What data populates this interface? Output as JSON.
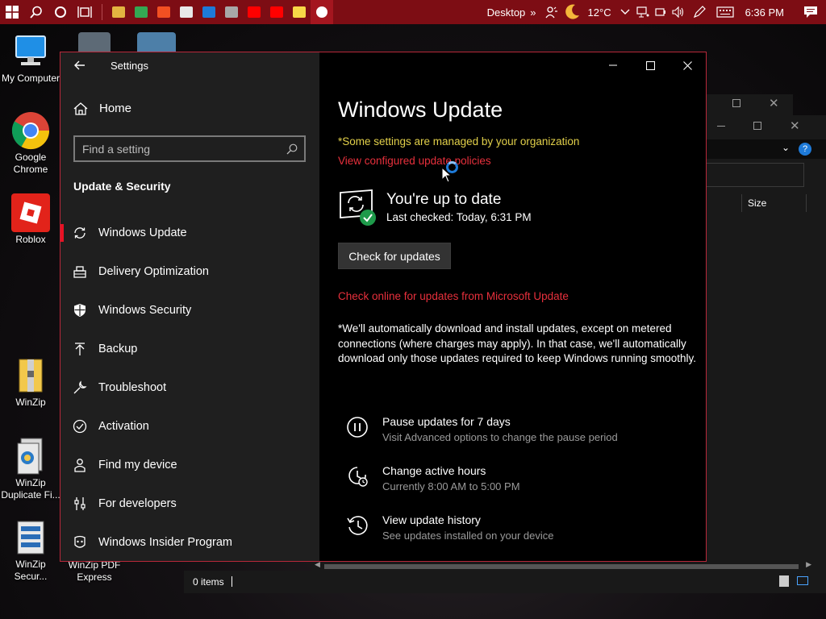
{
  "taskbar": {
    "desktop_label": "Desktop",
    "overflow_label": "»",
    "weather": "12°C",
    "time": "6:36 PM",
    "pinned_apps": [
      {
        "name": "file-explorer",
        "color": "#e3b341"
      },
      {
        "name": "chrome",
        "color": "#34a853"
      },
      {
        "name": "store",
        "color": "#f25022"
      },
      {
        "name": "roblox",
        "color": "#e8e8e8"
      },
      {
        "name": "remote",
        "color": "#1e7ad8"
      },
      {
        "name": "photos",
        "color": "#a8a8a8"
      },
      {
        "name": "youtube",
        "color": "#ff0000"
      },
      {
        "name": "youtube-2",
        "color": "#ff0000"
      },
      {
        "name": "sticky-notes",
        "color": "#f7d747"
      },
      {
        "name": "settings",
        "color": "#ffffff"
      }
    ]
  },
  "desktop": {
    "icons": [
      {
        "label": "My Computer",
        "icon": "monitor-icon"
      },
      {
        "label": "Google Chrome",
        "icon": "chrome-icon"
      },
      {
        "label": "Roblox",
        "icon": "roblox-icon"
      },
      {
        "label": "WinZip",
        "icon": "winzip-icon"
      },
      {
        "label": "WinZip Duplicate Fi...",
        "icon": "winzip-duplicate-icon"
      },
      {
        "label": "WinZip Secur...",
        "icon": "winzip-secure-icon"
      },
      {
        "label": "WinZip PDF Express",
        "icon": "winzip-pdf-icon"
      }
    ]
  },
  "explorer": {
    "column_size": "Size",
    "items_count": "0 items"
  },
  "settings": {
    "window_title": "Settings",
    "home_label": "Home",
    "search_placeholder": "Find a setting",
    "section_title": "Update & Security",
    "nav": [
      {
        "label": "Windows Update",
        "icon": "refresh-icon",
        "selected": true
      },
      {
        "label": "Delivery Optimization",
        "icon": "delivery-icon"
      },
      {
        "label": "Windows Security",
        "icon": "shield-icon"
      },
      {
        "label": "Backup",
        "icon": "backup-icon"
      },
      {
        "label": "Troubleshoot",
        "icon": "wrench-icon"
      },
      {
        "label": "Activation",
        "icon": "check-circle-icon"
      },
      {
        "label": "Find my device",
        "icon": "person-pin-icon"
      },
      {
        "label": "For developers",
        "icon": "developer-icon"
      },
      {
        "label": "Windows Insider Program",
        "icon": "insider-icon"
      }
    ],
    "main": {
      "title": "Windows Update",
      "managed_notice": "*Some settings are managed by your organization",
      "policies_link": "View configured update policies",
      "status_title": "You're up to date",
      "status_sub": "Last checked: Today, 6:31 PM",
      "check_button": "Check for updates",
      "online_link": "Check online for updates from Microsoft Update",
      "note": "*We'll automatically download and install updates, except on metered connections (where charges may apply). In that case, we'll automatically download only those updates required to keep Windows running smoothly.",
      "options": [
        {
          "title": "Pause updates for 7 days",
          "sub": "Visit Advanced options to change the pause period",
          "icon": "pause-icon"
        },
        {
          "title": "Change active hours",
          "sub": "Currently 8:00 AM to 5:00 PM",
          "icon": "clock-icon"
        },
        {
          "title": "View update history",
          "sub": "See updates installed on your device",
          "icon": "history-icon"
        }
      ]
    }
  },
  "colors": {
    "taskbar": "#7d0d14",
    "accent_red": "#e81123",
    "link_red": "#e8303c",
    "notice_yellow": "#e2d04a",
    "success_green": "#1e9a4a"
  }
}
